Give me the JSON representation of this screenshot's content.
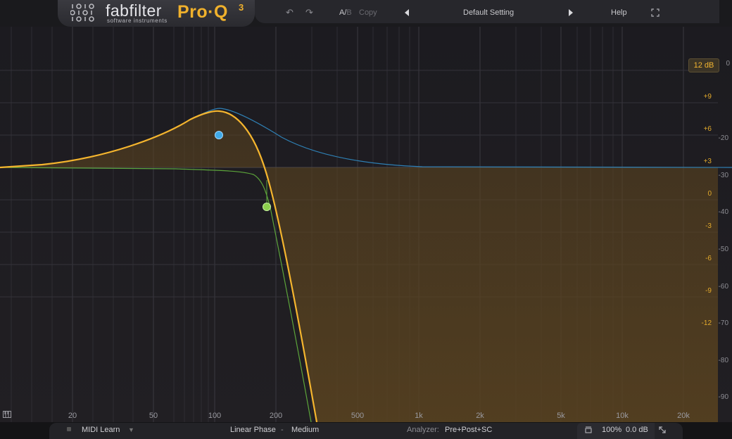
{
  "header": {
    "brand": "fabfilter",
    "brand_sub": "software instruments",
    "product": "Pro·Q",
    "product_version": "3",
    "ab_label": "A/",
    "ab_b_label": "B",
    "copy_label": "Copy",
    "preset_name": "Default Setting",
    "help_label": "Help",
    "icons": {
      "undo": "undo-icon",
      "redo": "redo-icon",
      "prev_preset": "triangle-left-icon",
      "next_preset": "triangle-right-icon",
      "fullscreen": "fullscreen-icon"
    }
  },
  "graph": {
    "db_range": "12 dB",
    "top_right_label": "0",
    "gain_labels": [
      "+9",
      "+6",
      "+3",
      "0",
      "-3",
      "-6",
      "-9",
      "-12"
    ],
    "analyzer_labels": [
      "-20",
      "-30",
      "-40",
      "-50",
      "-60",
      "-70",
      "-80",
      "-90"
    ],
    "freq_labels": [
      "20",
      "50",
      "100",
      "200",
      "500",
      "1k",
      "2k",
      "5k",
      "10k",
      "20k"
    ],
    "colors": {
      "response_curve": "#f5b52e",
      "bell_band": "#3fa9e8",
      "lowpass_band": "#7cc44a",
      "fill": "#4a3a1f"
    },
    "bands": [
      {
        "type": "bell",
        "freq_hz": 100,
        "gain_db": 6.2,
        "color": "#3fa9e8"
      },
      {
        "type": "low-cut",
        "freq_hz": 180,
        "gain_db": -1.2,
        "color": "#8ccf4e"
      }
    ]
  },
  "footer": {
    "midi_learn": "MIDI Learn",
    "phase_mode": "Linear Phase",
    "separator": "-",
    "phase_amount": "Medium",
    "analyzer_label": "Analyzer:",
    "analyzer_value": "Pre+Post+SC",
    "zoom": "100%",
    "output_gain": "0.0 dB"
  }
}
